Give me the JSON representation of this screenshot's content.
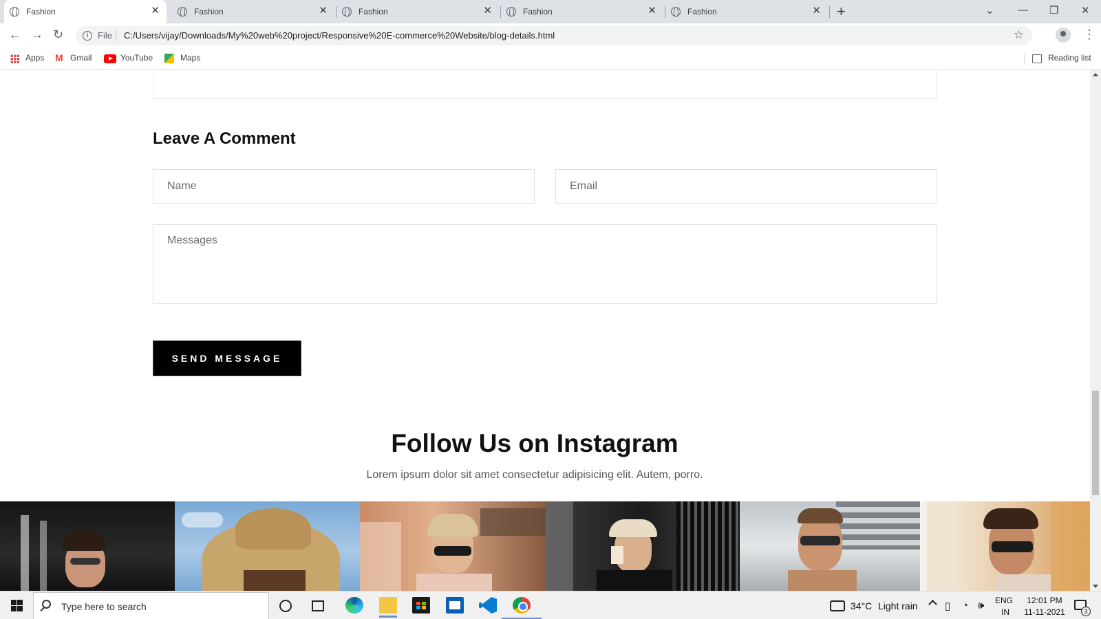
{
  "browser": {
    "tabs": [
      {
        "label": "Fashion",
        "active": true
      },
      {
        "label": "Fashion",
        "active": false
      },
      {
        "label": "Fashion",
        "active": false
      },
      {
        "label": "Fashion",
        "active": false
      },
      {
        "label": "Fashion",
        "active": false
      }
    ],
    "file_label": "File",
    "url": "C:/Users/vijay/Downloads/My%20web%20project/Responsive%20E-commerce%20Website/blog-details.html",
    "bookmarks": [
      {
        "label": "Apps",
        "icon": "apps-icon"
      },
      {
        "label": "Gmail",
        "icon": "gmail-icon"
      },
      {
        "label": "YouTube",
        "icon": "youtube-icon"
      },
      {
        "label": "Maps",
        "icon": "maps-icon"
      }
    ],
    "reading_list": "Reading list"
  },
  "page": {
    "comment_title": "Leave A Comment",
    "name_placeholder": "Name",
    "email_placeholder": "Email",
    "messages_placeholder": "Messages",
    "send_button": "SEND MESSAGE",
    "instagram_title": "Follow Us on Instagram",
    "instagram_subtitle": "Lorem ipsum dolor sit amet consectetur adipisicing elit. Autem, porro.",
    "instagram_photos": [
      "woman-sunglasses-dark",
      "straw-hat-sky",
      "woman-sunglasses-building",
      "woman-coffee-gate",
      "man-sunglasses",
      "woman-sunglasses-bright"
    ]
  },
  "taskbar": {
    "search_placeholder": "Type here to search",
    "weather_temp": "34°C",
    "weather_desc": "Light rain",
    "lang_top": "ENG",
    "lang_bottom": "IN",
    "time": "12:01 PM",
    "date": "11-11-2021",
    "notification_count": "3"
  }
}
